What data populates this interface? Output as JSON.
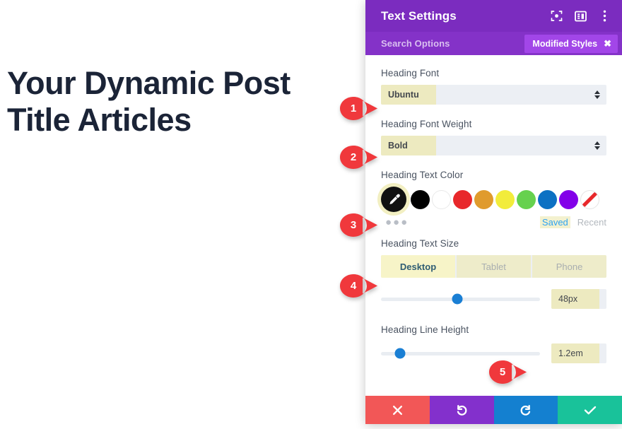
{
  "page": {
    "post_title": "Your Dynamic Post Title Articles",
    "title_color": "#1b2437",
    "background": "#ffffff"
  },
  "panel": {
    "title": "Text Settings",
    "header_color": "#7b2cbf",
    "search_bar_color": "#8432c8",
    "header_icons": [
      {
        "name": "focus-target-icon",
        "label": "focus"
      },
      {
        "name": "layout-panel-icon",
        "label": "layout"
      },
      {
        "name": "more-vertical-icon",
        "label": "more"
      }
    ],
    "search": {
      "placeholder": "Search Options",
      "badge_label": "Modified Styles",
      "badge_close": "✖",
      "badge_color": "#a246e8"
    },
    "fields": {
      "heading_font": {
        "label": "Heading Font",
        "value": "Ubuntu"
      },
      "heading_font_weight": {
        "label": "Heading Font Weight",
        "value": "Bold"
      },
      "heading_text_color": {
        "label": "Heading Text Color",
        "eyedropper_icon": "eyedropper-icon",
        "swatches": [
          {
            "name": "swatch-black",
            "color": "#000000"
          },
          {
            "name": "swatch-white",
            "color": "#ffffff"
          },
          {
            "name": "swatch-red",
            "color": "#e8282b"
          },
          {
            "name": "swatch-orange",
            "color": "#e09b2d"
          },
          {
            "name": "swatch-yellow",
            "color": "#f2ec3b"
          },
          {
            "name": "swatch-green",
            "color": "#66d14e"
          },
          {
            "name": "swatch-blue",
            "color": "#0c71c3"
          },
          {
            "name": "swatch-purple",
            "color": "#8300e9"
          },
          {
            "name": "swatch-none",
            "color": "none"
          }
        ],
        "more_dots": "●●●",
        "saved_label": "Saved",
        "recent_label": "Recent"
      },
      "heading_text_size": {
        "label": "Heading Text Size",
        "devices": [
          {
            "name": "desktop",
            "label": "Desktop",
            "active": true
          },
          {
            "name": "tablet",
            "label": "Tablet",
            "active": false
          },
          {
            "name": "phone",
            "label": "Phone",
            "active": false
          }
        ],
        "value": "48px",
        "slider_percent": 48
      },
      "heading_line_height": {
        "label": "Heading Line Height",
        "value": "1.2em",
        "slider_percent": 12
      }
    },
    "footer": [
      {
        "name": "cancel-button",
        "icon": "✖",
        "color": "#f25757"
      },
      {
        "name": "undo-button",
        "icon": "↺",
        "color": "#8330cc"
      },
      {
        "name": "redo-button",
        "icon": "↻",
        "color": "#1480d0"
      },
      {
        "name": "save-button",
        "icon": "✔",
        "color": "#19c29a"
      }
    ]
  },
  "annotations": {
    "color": "#f0383c",
    "markers": [
      {
        "number": "1",
        "target": "heading-font-select"
      },
      {
        "number": "2",
        "target": "heading-font-weight-select"
      },
      {
        "number": "3",
        "target": "heading-text-color-eyedropper"
      },
      {
        "number": "4",
        "target": "device-tab-desktop"
      },
      {
        "number": "5",
        "target": "heading-line-height-value"
      }
    ]
  }
}
